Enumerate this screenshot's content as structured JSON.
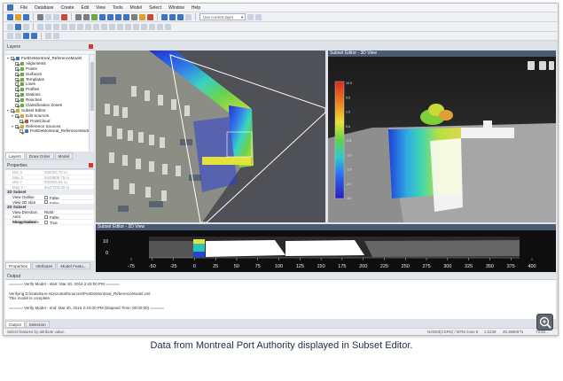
{
  "menu": [
    "File",
    "Database",
    "Create",
    "Edit",
    "View",
    "Tools",
    "Model",
    "Select",
    "Window",
    "Help"
  ],
  "toolbar": {
    "layer_select": "Use current layer"
  },
  "layers_panel": {
    "title": "Layers",
    "items": [
      {
        "label": "FortDeMontreal_ReferenceModel",
        "level": 0,
        "checked": true,
        "icon_color": "#3d74c4"
      },
      {
        "label": "Alignments",
        "level": 1,
        "checked": true,
        "icon_color": "#6fa64a"
      },
      {
        "label": "Points",
        "level": 1,
        "checked": true,
        "icon_color": "#6fa64a"
      },
      {
        "label": "Surfaces",
        "level": 1,
        "checked": true,
        "icon_color": "#6fa64a"
      },
      {
        "label": "Templates",
        "level": 1,
        "checked": true,
        "icon_color": "#6fa64a"
      },
      {
        "label": "Lines",
        "level": 1,
        "checked": true,
        "icon_color": "#6fa64a"
      },
      {
        "label": "Profiles",
        "level": 1,
        "checked": true,
        "icon_color": "#6fa64a"
      },
      {
        "label": "Stations",
        "level": 1,
        "checked": true,
        "icon_color": "#6fa64a"
      },
      {
        "label": "Reaches",
        "level": 1,
        "checked": true,
        "icon_color": "#6fa64a"
      },
      {
        "label": "Classification Zones",
        "level": 1,
        "checked": true,
        "icon_color": "#6fa64a"
      },
      {
        "label": "Subset Editor",
        "level": 0,
        "checked": true,
        "icon_color": "#e0a030"
      },
      {
        "label": "Edit Sources",
        "level": 1,
        "checked": true,
        "icon_color": "#e0a030"
      },
      {
        "label": "PointCloud",
        "level": 2,
        "checked": true,
        "icon_color": "#c84a3a"
      },
      {
        "label": "Reference Sources",
        "level": 1,
        "checked": true,
        "icon_color": "#e0a030"
      },
      {
        "label": "PortDeMontreal_ReferenceModel",
        "level": 2,
        "checked": true,
        "icon_color": "#3d74c4"
      }
    ],
    "tabs": [
      "Layers",
      "Draw Order",
      "Model"
    ]
  },
  "properties_panel": {
    "title": "Properties",
    "rows": [
      {
        "type": "row",
        "key": "Min X",
        "value": "300026.70 m"
      },
      {
        "type": "row",
        "key": "Max X",
        "value": "5049806.75 m"
      },
      {
        "type": "row",
        "key": "Min Y",
        "value": "300826.95 m"
      },
      {
        "type": "row",
        "key": "Max Y",
        "value": "5047703.00 m"
      },
      {
        "type": "section",
        "key": "3D Subset"
      },
      {
        "type": "row",
        "key": "View Outline",
        "value": "False",
        "checkbox": true,
        "active": true
      },
      {
        "type": "row",
        "key": "View 2D slice",
        "value": "False",
        "checkbox": true,
        "active": true
      },
      {
        "type": "section",
        "key": "2D Subset"
      },
      {
        "type": "row",
        "key": "View Direction",
        "value": "Right",
        "active": true
      },
      {
        "type": "row",
        "key": "Auto Exaggeration",
        "value": "False",
        "checkbox": true,
        "active": true
      },
      {
        "type": "row",
        "key": "Show Graticule",
        "value": "True",
        "checkbox": true,
        "active": true
      }
    ],
    "tabs": [
      "Properties",
      "Attributes",
      "Model Featu..."
    ]
  },
  "view_3d": {
    "title": "Subset Editor - 3D View",
    "legend": [
      "10.0",
      "5.0",
      "1.0",
      "0.0",
      "-0.5",
      "-1.0",
      "-1.5",
      "-2.0",
      "-4.0"
    ]
  },
  "view_profile": {
    "title": "Subset Editor - 2D View",
    "y_ticks": [
      "10",
      "0"
    ],
    "x_ticks": [
      "-75",
      "-50",
      "-25",
      "0",
      "25",
      "50",
      "75",
      "100",
      "125",
      "150",
      "175",
      "200",
      "225",
      "250",
      "275",
      "300",
      "325",
      "350",
      "375",
      "400"
    ]
  },
  "output_panel": {
    "title": "Output",
    "lines": [
      "====== Verify Model - start: Mar 30, 2016 2:43:00 PM ======",
      "",
      "Verifying D:\\Data\\Non-Horizontal\\Sources\\PortDeMontreal_ReferenceModel.xml",
      "This model is complete.",
      "",
      "====== Verify Model - end: Mar 30, 2016 2:43:00 PM (Elapsed Time: 00:00:00) ======"
    ],
    "tabs": [
      "Output",
      "Selection"
    ]
  },
  "status": {
    "left": "Select features by attribute value.",
    "crs": "NAD83(CSRS) / MTM zone 8",
    "scale": "1:2239",
    "coord_y": "45.36909°N",
    "coord_x": "73.53..."
  },
  "caption": "Data from Montreal Port Authority displayed in Subset Editor."
}
